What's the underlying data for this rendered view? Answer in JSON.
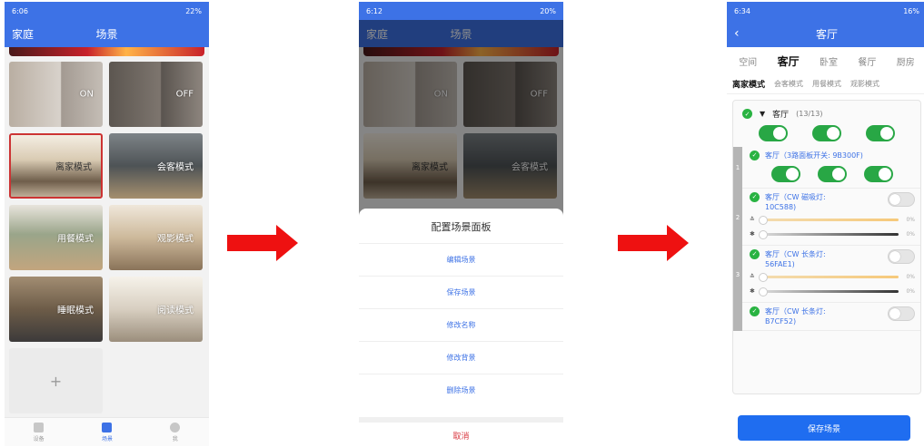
{
  "screen1": {
    "status": {
      "time": "6:06",
      "battery": "22%"
    },
    "header": {
      "left": "家庭",
      "title": "场景"
    },
    "tiles": [
      {
        "id": "on",
        "label": "ON"
      },
      {
        "id": "off",
        "label": "OFF"
      },
      {
        "id": "away",
        "label": "离家模式",
        "selected": true
      },
      {
        "id": "guest",
        "label": "会客模式"
      },
      {
        "id": "dine",
        "label": "用餐模式"
      },
      {
        "id": "movie",
        "label": "观影模式"
      },
      {
        "id": "sleep",
        "label": "睡眠模式"
      },
      {
        "id": "read",
        "label": "阅读模式"
      }
    ],
    "add_label": "+",
    "nav": [
      {
        "label": "设备",
        "icon": "device-icon"
      },
      {
        "label": "场景",
        "icon": "scene-icon",
        "active": true
      },
      {
        "label": "我",
        "icon": "person-icon"
      }
    ]
  },
  "screen2": {
    "status": {
      "time": "6:12",
      "battery": "20%"
    },
    "header": {
      "left": "家庭",
      "title": "场景"
    },
    "bg_tiles": [
      {
        "label": "ON"
      },
      {
        "label": "OFF"
      },
      {
        "label": "离家模式"
      },
      {
        "label": "会客模式"
      }
    ],
    "sheet": {
      "title": "配置场景面板",
      "options": [
        "编辑场景",
        "保存场景",
        "修改名称",
        "修改背景",
        "删除场景"
      ],
      "cancel": "取消"
    }
  },
  "screen3": {
    "status": {
      "time": "6:34",
      "battery": "16%"
    },
    "header": {
      "back": "‹",
      "title": "客厅"
    },
    "room_tabs": [
      "空间",
      "客厅",
      "卧室",
      "餐厅",
      "厨房"
    ],
    "active_room": "客厅",
    "scene_tabs": [
      "离家模式",
      "会客模式",
      "用餐模式",
      "观影模式"
    ],
    "active_scene": "离家模式",
    "group": {
      "name": "客厅",
      "count": "(13/13)"
    },
    "devices": [
      {
        "index": "1",
        "name": "客厅（3路面板开关: 9B300F)",
        "type": "switch3"
      },
      {
        "index": "2",
        "name": "客厅（CW 磁吸灯:",
        "name2": "10C588)",
        "type": "cw",
        "warm": "0%",
        "bright": "0%"
      },
      {
        "index": "3",
        "name": "客厅（CW 长条灯:",
        "name2": "56FAE1)",
        "type": "cw",
        "warm": "0%",
        "bright": "0%"
      },
      {
        "index": "4",
        "name": "客厅（CW 长条灯:",
        "name2": "B7CF52)",
        "type": "cwpartial"
      }
    ],
    "save_button": "保存场景"
  },
  "colors": {
    "primary": "#3d72e6",
    "arrow": "#ee1111",
    "switch_on": "#28a745",
    "cancel": "#d9363e"
  }
}
